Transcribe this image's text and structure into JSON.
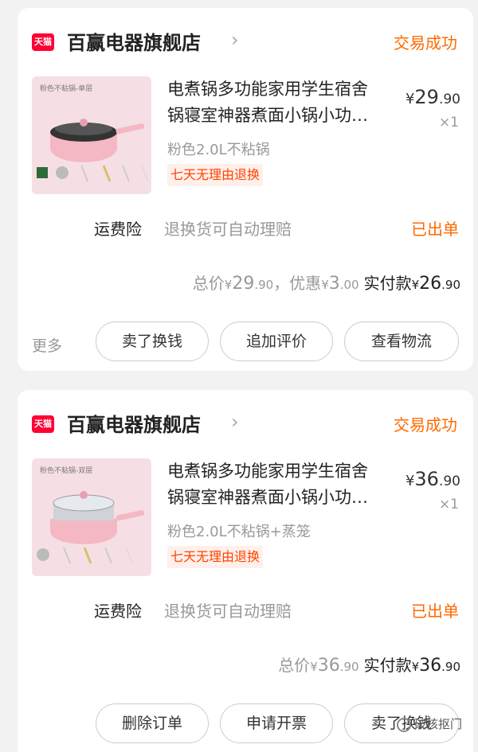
{
  "orders": [
    {
      "shop_logo_text": "天猫",
      "shop_name": "百赢电器旗舰店",
      "status": "交易成功",
      "thumb_label": "粉色不粘锅-单层",
      "title_line1": "电煮锅多功能家用学生宿舍",
      "title_line2": "锅寝室神器煮面小锅小功…",
      "sku": "粉色2.0L不粘锅",
      "tag": "七天无理由退换",
      "price_int": "29",
      "price_dec": ".90",
      "qty": "×1",
      "insurance_label": "运费险",
      "insurance_desc": "退换货可自动理赔",
      "insurance_status": "已出单",
      "total_label": "总价",
      "total_int": "29",
      "total_dec": ".90",
      "discount_label": "，优惠",
      "discount_int": "3",
      "discount_dec": ".00",
      "paid_label": "实付款",
      "paid_int": "26",
      "paid_dec": ".90",
      "more_label": "更多",
      "buttons": [
        "卖了换钱",
        "追加评价",
        "查看物流"
      ]
    },
    {
      "shop_logo_text": "天猫",
      "shop_name": "百赢电器旗舰店",
      "status": "交易成功",
      "thumb_label": "粉色不粘锅-双层",
      "title_line1": "电煮锅多功能家用学生宿舍",
      "title_line2": "锅寝室神器煮面小锅小功…",
      "sku": "粉色2.0L不粘锅+蒸笼",
      "tag": "七天无理由退换",
      "price_int": "36",
      "price_dec": ".90",
      "qty": "×1",
      "insurance_label": "运费险",
      "insurance_desc": "退换货可自动理赔",
      "insurance_status": "已出单",
      "total_label": "总价",
      "total_int": "36",
      "total_dec": ".90",
      "paid_label": "实付款",
      "paid_int": "36",
      "paid_dec": ".90",
      "buttons": [
        "删除订单",
        "申请开票",
        "卖了换钱"
      ]
    }
  ],
  "currency": "¥",
  "watermark": "破核抠门",
  "colors": {
    "status": "#ff6a00",
    "tag_text": "#ff4400",
    "tag_bg": "#fff0eb",
    "tmall_red": "#ff0036"
  }
}
